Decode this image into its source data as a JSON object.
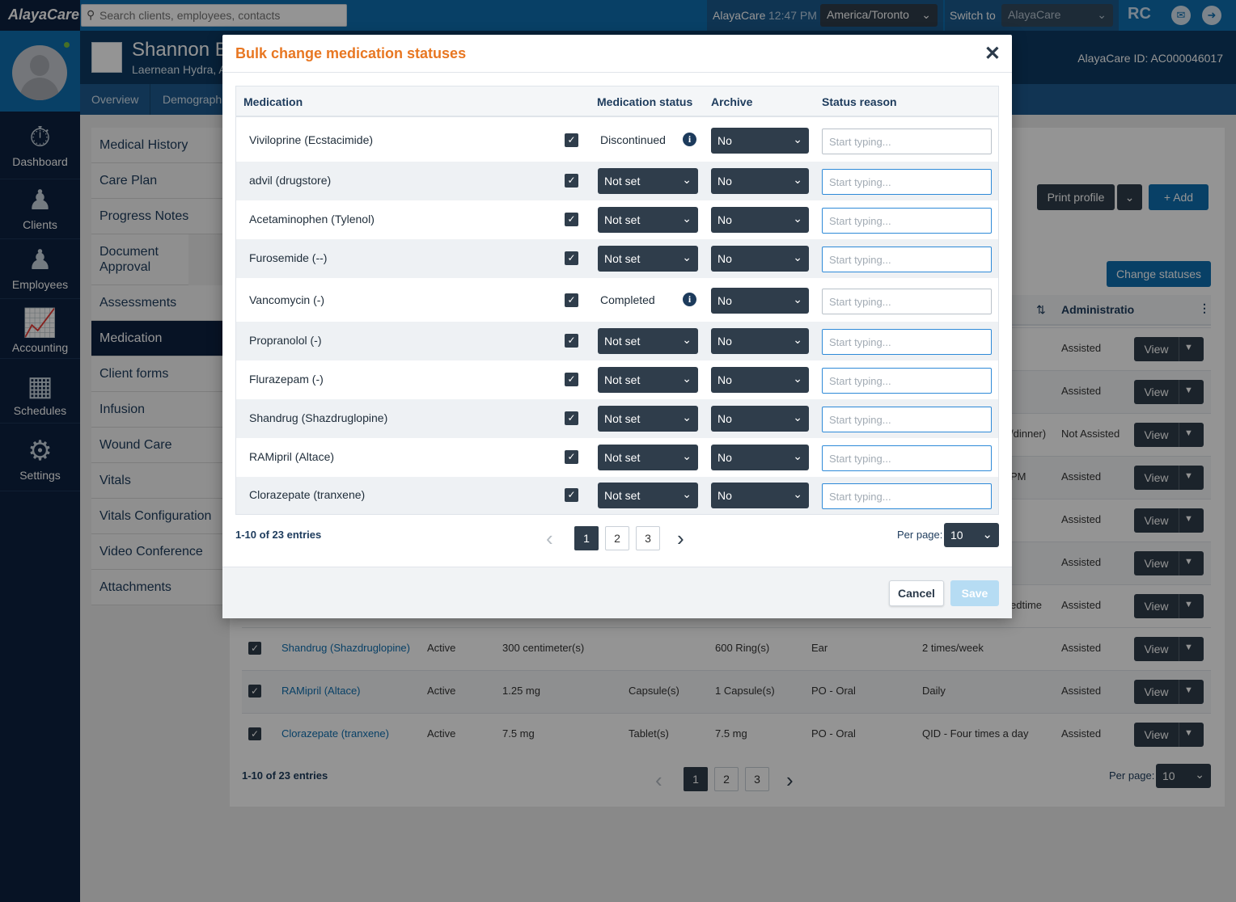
{
  "topbar": {
    "logo": "AlayaCare",
    "search_placeholder": "Search clients, employees, contacts",
    "org": "AlayaCare",
    "time": "12:47 PM",
    "timezone": "America/Toronto",
    "switch_label": "Switch to",
    "switch_value": "AlayaCare",
    "initials": "RC"
  },
  "profile": {
    "name": "Shannon B",
    "subtitle": "Laernean Hydra, A",
    "id_label": "AlayaCare ID: AC000046017"
  },
  "profile_tabs": [
    "Overview",
    "Demograph"
  ],
  "leftnav": [
    {
      "label": "Dashboard",
      "icon": "dashboard-icon"
    },
    {
      "label": "Clients",
      "icon": "clients-icon"
    },
    {
      "label": "Employees",
      "icon": "employees-icon"
    },
    {
      "label": "Accounting",
      "icon": "accounting-icon"
    },
    {
      "label": "Schedules",
      "icon": "schedules-icon"
    },
    {
      "label": "Settings",
      "icon": "settings-icon"
    }
  ],
  "sidemenu": [
    "Medical History",
    "Care Plan",
    "Progress Notes",
    "Document Approval",
    "Assessments",
    "Medication",
    "Client forms",
    "Infusion",
    "Wound Care",
    "Vitals",
    "Vitals Configuration",
    "Video Conference",
    "Attachments"
  ],
  "sidemenu_active": "Medication",
  "background": {
    "print_profile": "Print profile",
    "add": "Add",
    "change_statuses": "Change statuses",
    "admin_header": "Administratio",
    "view_label": "View",
    "partial_rows": [
      {
        "col9": "",
        "admin": "Assisted"
      },
      {
        "col9": "",
        "admin": "Assisted"
      },
      {
        "col9": "/dinner)",
        "admin": "Not Assisted"
      },
      {
        "col9": "PM",
        "admin": "Assisted"
      },
      {
        "col9": "",
        "admin": "Assisted"
      },
      {
        "col9": "",
        "admin": "Assisted"
      },
      {
        "col9": "edtime",
        "admin": "Assisted"
      }
    ],
    "rows": [
      {
        "name": "Shandrug (Shazdruglopine)",
        "status": "Active",
        "dose": "300 centimeter(s)",
        "form": "",
        "qty": "600 Ring(s)",
        "route": "Ear",
        "freq": "2 times/week",
        "admin": "Assisted"
      },
      {
        "name": "RAMipril (Altace)",
        "status": "Active",
        "dose": "1.25 mg",
        "form": "Capsule(s)",
        "qty": "1 Capsule(s)",
        "route": "PO - Oral",
        "freq": "Daily",
        "admin": "Assisted"
      },
      {
        "name": "Clorazepate (tranxene)",
        "status": "Active",
        "dose": "7.5 mg",
        "form": "Tablet(s)",
        "qty": "7.5 mg",
        "route": "PO - Oral",
        "freq": "QID - Four times a day",
        "admin": "Assisted"
      }
    ],
    "entries": "1-10 of 23 entries",
    "pages": [
      "1",
      "2",
      "3"
    ],
    "per_page_label": "Per page:",
    "per_page_value": "10"
  },
  "modal": {
    "title": "Bulk change medication statuses",
    "columns": {
      "medication": "Medication",
      "status": "Medication status",
      "archive": "Archive",
      "reason": "Status reason"
    },
    "rows": [
      {
        "medication": "Viviloprine (Ecstacimide)",
        "status": "Discontinued",
        "status_type": "text",
        "archive": "No",
        "reason_placeholder": "Start typing..."
      },
      {
        "medication": "advil (drugstore)",
        "status": "Not set",
        "status_type": "select",
        "archive": "No",
        "reason_placeholder": "Start typing..."
      },
      {
        "medication": "Acetaminophen (Tylenol)",
        "status": "Not set",
        "status_type": "select",
        "archive": "No",
        "reason_placeholder": "Start typing..."
      },
      {
        "medication": "Furosemide (--)",
        "status": "Not set",
        "status_type": "select",
        "archive": "No",
        "reason_placeholder": "Start typing..."
      },
      {
        "medication": "Vancomycin (-)",
        "status": "Completed",
        "status_type": "text",
        "archive": "No",
        "reason_placeholder": "Start typing..."
      },
      {
        "medication": "Propranolol (-)",
        "status": "Not set",
        "status_type": "select",
        "archive": "No",
        "reason_placeholder": "Start typing..."
      },
      {
        "medication": "Flurazepam (-)",
        "status": "Not set",
        "status_type": "select",
        "archive": "No",
        "reason_placeholder": "Start typing..."
      },
      {
        "medication": "Shandrug (Shazdruglopine)",
        "status": "Not set",
        "status_type": "select",
        "archive": "No",
        "reason_placeholder": "Start typing..."
      },
      {
        "medication": "RAMipril (Altace)",
        "status": "Not set",
        "status_type": "select",
        "archive": "No",
        "reason_placeholder": "Start typing..."
      },
      {
        "medication": "Clorazepate (tranxene)",
        "status": "Not set",
        "status_type": "select",
        "archive": "No",
        "reason_placeholder": "Start typing..."
      }
    ],
    "entries": "1-10 of 23 entries",
    "pages": [
      "1",
      "2",
      "3"
    ],
    "current_page": "1",
    "per_page_label": "Per page:",
    "per_page_value": "10",
    "cancel": "Cancel",
    "save": "Save"
  },
  "colors": {
    "brand_blue": "#0f6fb0",
    "navy": "#0d2240",
    "title_orange": "#e87722",
    "control_dark": "#2f3d4b"
  }
}
